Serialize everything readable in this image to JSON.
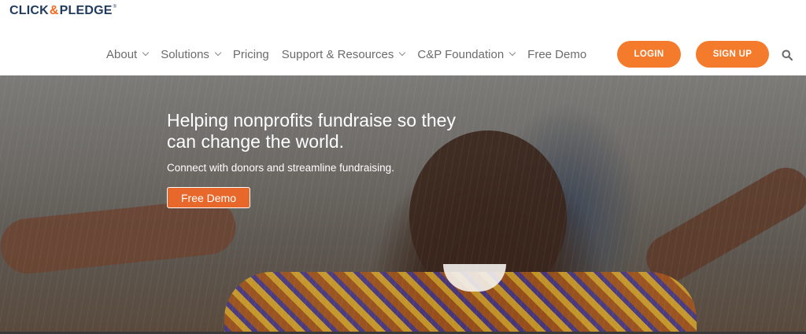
{
  "logo": {
    "part1": "CLICK",
    "amp": "&",
    "part2": "PLEDGE",
    "reg": "®"
  },
  "nav": {
    "items": [
      {
        "label": "About",
        "dropdown": true
      },
      {
        "label": "Solutions",
        "dropdown": true
      },
      {
        "label": "Pricing",
        "dropdown": false
      },
      {
        "label": "Support & Resources",
        "dropdown": true
      },
      {
        "label": "C&P Foundation",
        "dropdown": true
      },
      {
        "label": "Free Demo",
        "dropdown": false
      }
    ],
    "login_label": "LOGIN",
    "signup_label": "SIGN UP",
    "search_icon": "search-icon"
  },
  "hero": {
    "title": "Helping nonprofits fundraise so they can change the world.",
    "subtitle": "Connect with donors and streamline fundraising.",
    "cta_label": "Free Demo"
  },
  "colors": {
    "accent": "#f47a2c",
    "brand_navy": "#1f3a5c",
    "nav_text": "#6b6b6b"
  }
}
